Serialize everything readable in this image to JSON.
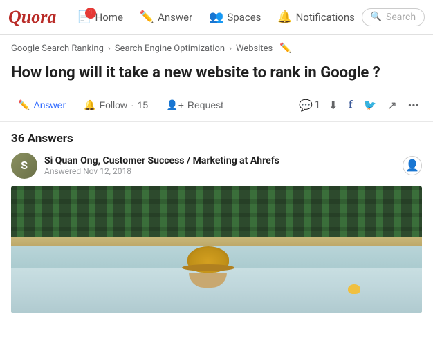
{
  "header": {
    "logo": "Quora",
    "nav": [
      {
        "id": "home",
        "label": "Home",
        "badge": "1",
        "icon": "📄"
      },
      {
        "id": "answer",
        "label": "Answer",
        "icon": "✏️"
      },
      {
        "id": "spaces",
        "label": "Spaces",
        "icon": "👥"
      },
      {
        "id": "notifications",
        "label": "Notifications",
        "icon": "🔔"
      }
    ],
    "search": {
      "placeholder": "Search"
    }
  },
  "breadcrumbs": [
    {
      "id": "bc1",
      "label": "Google Search Ranking"
    },
    {
      "id": "bc2",
      "label": "Search Engine Optimization"
    },
    {
      "id": "bc3",
      "label": "Websites"
    }
  ],
  "question": {
    "title": "How long will it take a new website to rank in Google ?",
    "actions": {
      "answer": "Answer",
      "follow": "Follow",
      "follow_count": "15",
      "request": "Request",
      "comment_count": "1"
    }
  },
  "answers": {
    "header": "36 Answers",
    "items": [
      {
        "author": "Si Quan Ong, Customer Success / Marketing at Ahrefs",
        "date": "Answered Nov 12, 2018"
      }
    ]
  }
}
